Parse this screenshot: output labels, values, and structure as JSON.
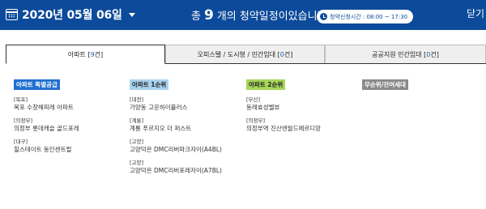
{
  "header": {
    "date": "2020년 05월 06일",
    "summary_prefix": "총",
    "summary_count": "9",
    "summary_suffix": "개의 청약일정이있습니다.",
    "time_label": "청약신청시간 : 08:00 ~ 17:30",
    "close_label": "닫기"
  },
  "tabs": [
    {
      "label": "아파트 [",
      "count": "9",
      "suffix": "건]",
      "active": true
    },
    {
      "label": "오피스텔 / 도시형 / 민간임대 [",
      "count": "0",
      "suffix": "건]",
      "active": false
    },
    {
      "label": "공공지원 민간임대 [",
      "count": "0",
      "suffix": "건]",
      "active": false
    }
  ],
  "columns": [
    {
      "title": "아파트 특별공급",
      "color": "#1f6fd0",
      "text_color": "#ffffff",
      "items": [
        {
          "region": "[목포]",
          "name": "목포 수창해피레 아파트"
        },
        {
          "region": "[의정부]",
          "name": "의정부 롯데캐슬 골드포레"
        },
        {
          "region": "[대구]",
          "name": "힐스테이트 동인센트럴"
        }
      ]
    },
    {
      "title": "아파트 1순위",
      "color": "#a9d3f0",
      "text_color": "#222222",
      "items": [
        {
          "region": "[대전]",
          "name": "가양동 고운하이플러스"
        },
        {
          "region": "[계룡]",
          "name": "계룡 푸르지오 더 퍼스트"
        },
        {
          "region": "[고양]",
          "name": "고양덕은 DMC리버파크자이(A4BL)"
        },
        {
          "region": "[고양]",
          "name": "고양덕은 DMC리버포레자이(A7BL)"
        }
      ]
    },
    {
      "title": "아파트 2순위",
      "color": "#a6d65a",
      "text_color": "#222222",
      "items": [
        {
          "region": "[부산]",
          "name": "동래효성벨뷰"
        },
        {
          "region": "[의정부]",
          "name": "의정부역 진산엔월드메르디앙"
        }
      ]
    },
    {
      "title": "무순위/잔여세대",
      "color": "#8a8a8a",
      "text_color": "#ffffff",
      "items": []
    }
  ]
}
